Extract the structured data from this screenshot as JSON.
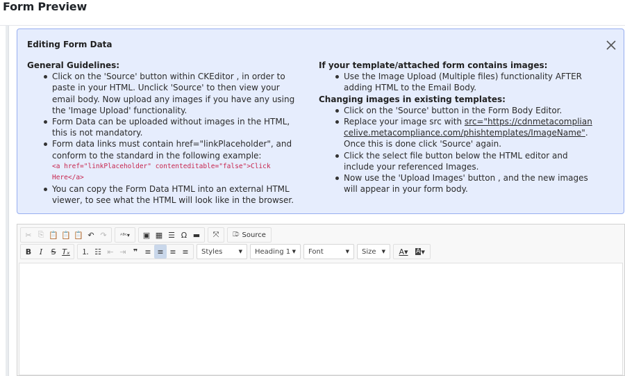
{
  "page": {
    "title": "Form Preview"
  },
  "info_panel": {
    "title": "Editing Form Data",
    "left": {
      "heading": "General Guidelines:",
      "items": [
        "Click on the 'Source' button within CKEditor , in order to paste in your HTML. Unclick 'Source' to then view your email body. Now upload any images if you have any using the 'Image Upload' functionality.",
        "Form Data can be uploaded without images in the HTML, this is not mandatory.",
        "Form data links must contain href=\"linkPlaceholder\", and conform to the standard in the following example:",
        "You can copy the Form Data HTML into an external HTML viewer, to see what the HTML will look like in the browser."
      ],
      "code_example": "<a href=\"linkPlaceholder\" contenteditable=\"false\">Click Here</a>"
    },
    "right": {
      "heading_images": "If your template/attached form contains images:",
      "images_item": "Use the Image Upload (Multiple files) functionality AFTER adding HTML to the Email Body.",
      "heading_changing": "Changing images in existing templates:",
      "change_item_1": "Click on the 'Source' button in the Form Body Editor.",
      "change_item_2_prefix": "Replace your image src with ",
      "change_item_2_link": "src=\"https://cdnmetacompliancelive.metacompliance.com/phishtemplates/ImageName\"",
      "change_item_2_suffix": ". Once this is done click 'Source' again.",
      "change_item_3": "Click the select file button below the HTML editor and include your referenced Images.",
      "change_item_4": "Now use the 'Upload Images' button , and the new images will appear in your form body."
    }
  },
  "editor": {
    "source_label": "Source",
    "styles_label": "Styles",
    "format_label": "Heading 1",
    "font_label": "Font",
    "size_label": "Size",
    "accent_color": "#c9d7ea"
  }
}
